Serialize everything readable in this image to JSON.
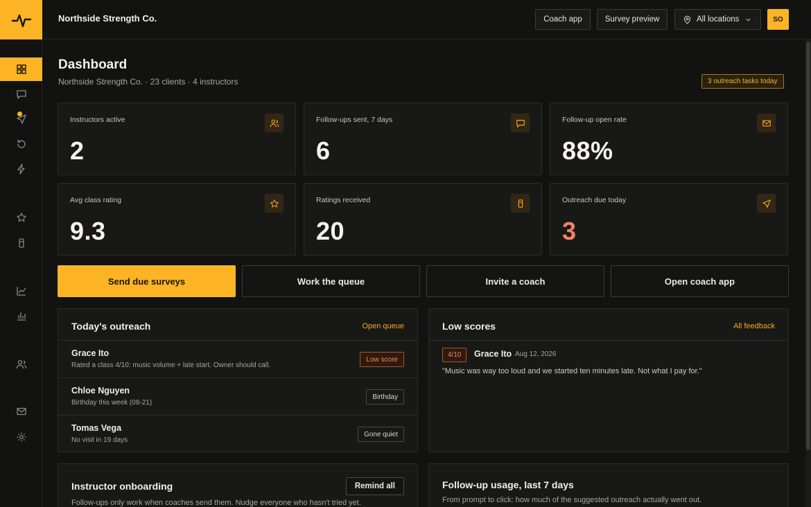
{
  "org": {
    "name": "Northside Strength Co."
  },
  "topbar": {
    "coach_app": "Coach app",
    "survey_preview": "Survey preview",
    "locations": "All locations",
    "avatar": "SO"
  },
  "page": {
    "title": "Dashboard",
    "subtitle": "Northside Strength Co. · 23 clients · 4 instructors",
    "tasks_badge": "3 outreach tasks today"
  },
  "stats": [
    {
      "label": "Instructors active",
      "value": "2",
      "icon": "users-icon"
    },
    {
      "label": "Follow-ups sent, 7 days",
      "value": "6",
      "icon": "message-icon"
    },
    {
      "label": "Follow-up open rate",
      "value": "88%",
      "icon": "mail-icon"
    },
    {
      "label": "Avg class rating",
      "value": "9.3",
      "icon": "star-icon"
    },
    {
      "label": "Ratings received",
      "value": "20",
      "icon": "cup-icon"
    },
    {
      "label": "Outreach due today",
      "value": "3",
      "icon": "send-icon"
    }
  ],
  "actions": {
    "send": "Send due surveys",
    "queue": "Work the queue",
    "invite": "Invite a coach",
    "open": "Open coach app"
  },
  "outreach": {
    "title": "Today's outreach",
    "link": "Open queue",
    "rows": [
      {
        "name": "Grace Ito",
        "note": "Rated a class 4/10: music volume + late start. Owner should call.",
        "tag": "Low score"
      },
      {
        "name": "Chloe Nguyen",
        "note": "Birthday this week (08-21)",
        "tag": "Birthday"
      },
      {
        "name": "Tomas Vega",
        "note": "No visit in 19 days",
        "tag": "Gone quiet"
      }
    ]
  },
  "low_scores": {
    "title": "Low scores",
    "link": "All feedback",
    "item": {
      "score": "4/10",
      "name": "Grace Ito",
      "date": "Aug 12, 2026",
      "quote": "\"Music was way too loud and we started ten minutes late. Not what I pay for.\""
    }
  },
  "onboarding": {
    "title": "Instructor onboarding",
    "button": "Remind all",
    "sub": "Follow-ups only work when coaches send them. Nudge everyone who hasn't tried yet."
  },
  "usage": {
    "title": "Follow-up usage, last 7 days",
    "sub": "From prompt to click: how much of the suggested outreach actually went out."
  },
  "colors": {
    "accent": "#fcb424",
    "alert": "#ef8467",
    "background": "#121311"
  }
}
